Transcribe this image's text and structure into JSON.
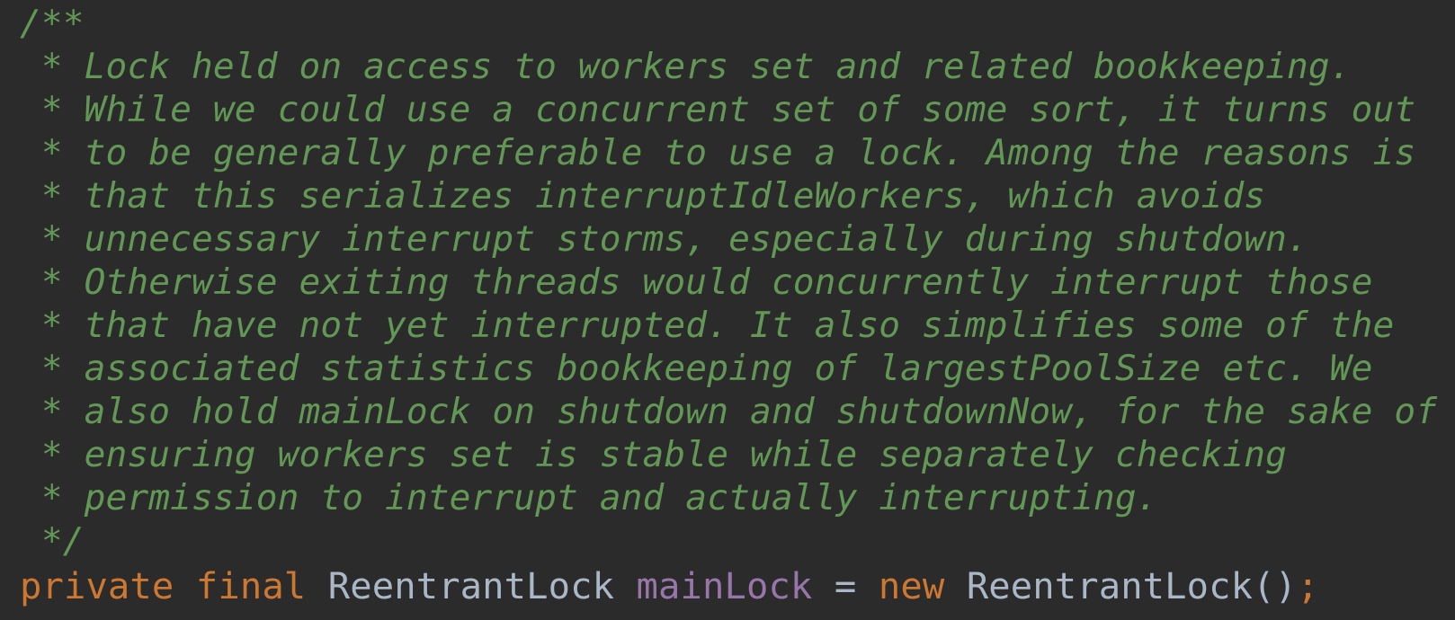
{
  "editor": {
    "background": "#2b2b2b",
    "colors": {
      "comment": "#629755",
      "keyword": "#cc7832",
      "identifier": "#a9b7c6",
      "field": "#9876aa"
    },
    "comment_lines": [
      "/**",
      " * Lock held on access to workers set and related bookkeeping.",
      " * While we could use a concurrent set of some sort, it turns out",
      " * to be generally preferable to use a lock. Among the reasons is",
      " * that this serializes interruptIdleWorkers, which avoids",
      " * unnecessary interrupt storms, especially during shutdown.",
      " * Otherwise exiting threads would concurrently interrupt those",
      " * that have not yet interrupted. It also simplifies some of the",
      " * associated statistics bookkeeping of largestPoolSize etc. We",
      " * also hold mainLock on shutdown and shutdownNow, for the sake of",
      " * ensuring workers set is stable while separately checking",
      " * permission to interrupt and actually interrupting.",
      " */"
    ],
    "declaration": {
      "kw_private": "private",
      "kw_final": "final",
      "type": "ReentrantLock",
      "name": "mainLock",
      "assign": "=",
      "kw_new": "new",
      "ctor": "ReentrantLock()",
      "semicolon": ";"
    }
  }
}
